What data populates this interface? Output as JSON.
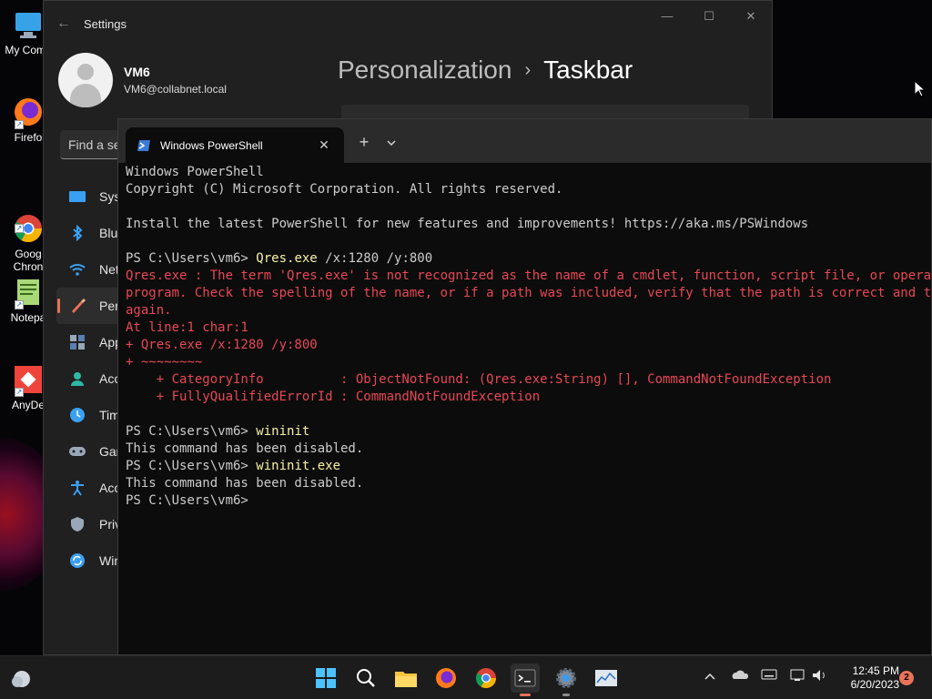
{
  "desktop": {
    "icons": [
      {
        "label": "My Comp",
        "icon": "monitor-icon"
      },
      {
        "label": "Firefo",
        "icon": "firefox-icon"
      },
      {
        "label": "Goog\nChron",
        "icon": "chrome-icon"
      },
      {
        "label": "Notepa",
        "icon": "notepad-icon"
      },
      {
        "label": "AnyDe",
        "icon": "anydesk-icon"
      }
    ]
  },
  "settings": {
    "title": "Settings",
    "user": {
      "name": "VM6",
      "email": "VM6@collabnet.local"
    },
    "search_placeholder": "Find a se",
    "nav": [
      {
        "label": "Syste",
        "icon": "system-icon",
        "color": "#3aa0f3"
      },
      {
        "label": "Blue",
        "icon": "bluetooth-icon",
        "color": "#3aa0f3"
      },
      {
        "label": "Netv",
        "icon": "wifi-icon",
        "color": "#3aa0f3"
      },
      {
        "label": "Pers",
        "icon": "brush-icon",
        "color": "#e8735a"
      },
      {
        "label": "App",
        "icon": "apps-icon",
        "color": "#9aa7b8"
      },
      {
        "label": "Acc",
        "icon": "accounts-icon",
        "color": "#2fb8a8"
      },
      {
        "label": "Time",
        "icon": "time-icon",
        "color": "#3aa0f3"
      },
      {
        "label": "Gan",
        "icon": "gaming-icon",
        "color": "#9aa7b8"
      },
      {
        "label": "Acc",
        "icon": "accessibility-icon",
        "color": "#3aa0f3"
      },
      {
        "label": "Priv",
        "icon": "shield-icon",
        "color": "#9aa7b8"
      },
      {
        "label": "Win",
        "icon": "update-icon",
        "color": "#3aa0f3"
      }
    ],
    "active_nav": 3,
    "breadcrumb": {
      "parent": "Personalization",
      "separator": "›",
      "current": "Taskbar"
    }
  },
  "terminal": {
    "tab_title": "Windows PowerShell",
    "colors": {
      "background": "#0c0c0c",
      "text": "#cccccc",
      "error": "#e74856",
      "command": "#f9f1a5"
    },
    "lines": [
      {
        "type": "out",
        "text": "Windows PowerShell"
      },
      {
        "type": "out",
        "text": "Copyright (C) Microsoft Corporation. All rights reserved."
      },
      {
        "type": "out",
        "text": ""
      },
      {
        "type": "out",
        "text": "Install the latest PowerShell for new features and improvements! https://aka.ms/PSWindows"
      },
      {
        "type": "out",
        "text": ""
      },
      {
        "type": "prompt",
        "prompt": "PS C:\\Users\\vm6> ",
        "cmd": "Qres.exe",
        "args": " /x:1280 /y:800"
      },
      {
        "type": "err",
        "text": "Qres.exe : The term 'Qres.exe' is not recognized as the name of a cmdlet, function, script file, or operable"
      },
      {
        "type": "err",
        "text": "program. Check the spelling of the name, or if a path was included, verify that the path is correct and try"
      },
      {
        "type": "err",
        "text": "again."
      },
      {
        "type": "err",
        "text": "At line:1 char:1"
      },
      {
        "type": "err",
        "text": "+ Qres.exe /x:1280 /y:800"
      },
      {
        "type": "err",
        "text": "+ ~~~~~~~~"
      },
      {
        "type": "err",
        "text": "    + CategoryInfo          : ObjectNotFound: (Qres.exe:String) [], CommandNotFoundException"
      },
      {
        "type": "err",
        "text": "    + FullyQualifiedErrorId : CommandNotFoundException"
      },
      {
        "type": "out",
        "text": ""
      },
      {
        "type": "prompt",
        "prompt": "PS C:\\Users\\vm6> ",
        "cmd": "wininit",
        "args": ""
      },
      {
        "type": "out",
        "text": "This command has been disabled."
      },
      {
        "type": "prompt",
        "prompt": "PS C:\\Users\\vm6> ",
        "cmd": "wininit.exe",
        "args": ""
      },
      {
        "type": "out",
        "text": "This command has been disabled."
      },
      {
        "type": "prompt",
        "prompt": "PS C:\\Users\\vm6> ",
        "cmd": "",
        "args": ""
      }
    ]
  },
  "taskbar": {
    "apps": [
      "start-icon",
      "search-icon",
      "file-explorer-icon",
      "firefox-icon",
      "chrome-icon",
      "terminal-icon",
      "settings-icon",
      "task-manager-icon"
    ],
    "time": "12:45 PM",
    "date": "6/20/2023",
    "notification_count": "2"
  }
}
